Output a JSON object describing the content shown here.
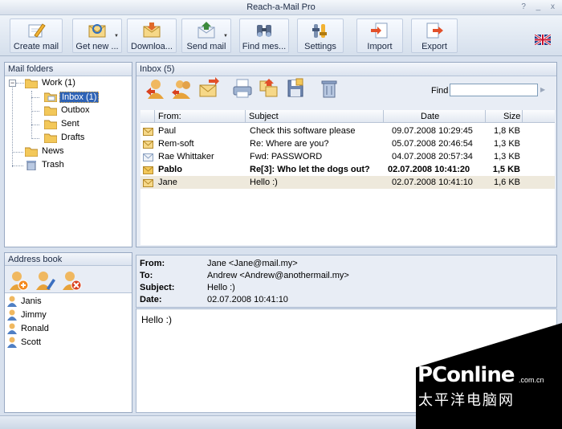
{
  "window": {
    "title": "Reach-a-Mail Pro",
    "controls": "? _ x"
  },
  "toolbar": {
    "buttons": [
      {
        "label": "Create mail",
        "icon": "pencil-icon"
      },
      {
        "label": "Get new ...",
        "icon": "get-mail-icon"
      },
      {
        "label": "Downloa...",
        "icon": "download-icon"
      },
      {
        "label": "Send mail",
        "icon": "send-mail-icon"
      },
      {
        "label": "Find mes...",
        "icon": "binoculars-icon"
      },
      {
        "label": "Settings",
        "icon": "settings-icon"
      },
      {
        "label": "Import",
        "icon": "import-icon"
      },
      {
        "label": "Export",
        "icon": "export-icon"
      }
    ],
    "language_icon": "uk-flag-icon"
  },
  "folders": {
    "header": "Mail folders",
    "items": [
      {
        "label": "Work (1)"
      },
      {
        "label": "Inbox (1)"
      },
      {
        "label": "Outbox"
      },
      {
        "label": "Sent"
      },
      {
        "label": "Drafts"
      },
      {
        "label": "News"
      },
      {
        "label": "Trash"
      }
    ]
  },
  "inbox": {
    "header": "Inbox (5)",
    "find_label": "Find",
    "find_value": "",
    "columns": [
      "From:",
      "Subject",
      "Date",
      "Size"
    ],
    "rows": [
      {
        "from": "Paul",
        "subject": "Check this software please",
        "date": "09.07.2008 10:29:45",
        "size": "1,8 KB"
      },
      {
        "from": "Rem-soft",
        "subject": "Re: Where are you?",
        "date": "05.07.2008 20:46:54",
        "size": "1,3 KB"
      },
      {
        "from": "Rae Whittaker",
        "subject": "Fwd: PASSWORD",
        "date": "04.07.2008 20:57:34",
        "size": "1,3 KB"
      },
      {
        "from": "Pablo",
        "subject": "Re[3]: Who let the dogs out?",
        "date": "02.07.2008 10:41:20",
        "size": "1,5 KB"
      },
      {
        "from": "Jane",
        "subject": "Hello :)",
        "date": "02.07.2008 10:41:10",
        "size": "1,6 KB"
      }
    ]
  },
  "preview": {
    "from_label": "From:",
    "from": "Jane <Jane@mail.my>",
    "to_label": "To:",
    "to": "Andrew <Andrew@anothermail.my>",
    "subject_label": "Subject:",
    "subject": "Hello :)",
    "date_label": "Date:",
    "date": "02.07.2008 10:41:10",
    "body": "Hello :)"
  },
  "addressbook": {
    "header": "Address book",
    "contacts": [
      "Janis",
      "Jimmy",
      "Ronald",
      "Scott"
    ]
  },
  "watermark": {
    "logo": "PConline",
    "domain": ".com.cn",
    "cn": "太平洋电脑网"
  },
  "colors": {
    "accent": "#2e63b6",
    "selected_row": "#eee9dc",
    "panel_border": "#98a9c2"
  }
}
